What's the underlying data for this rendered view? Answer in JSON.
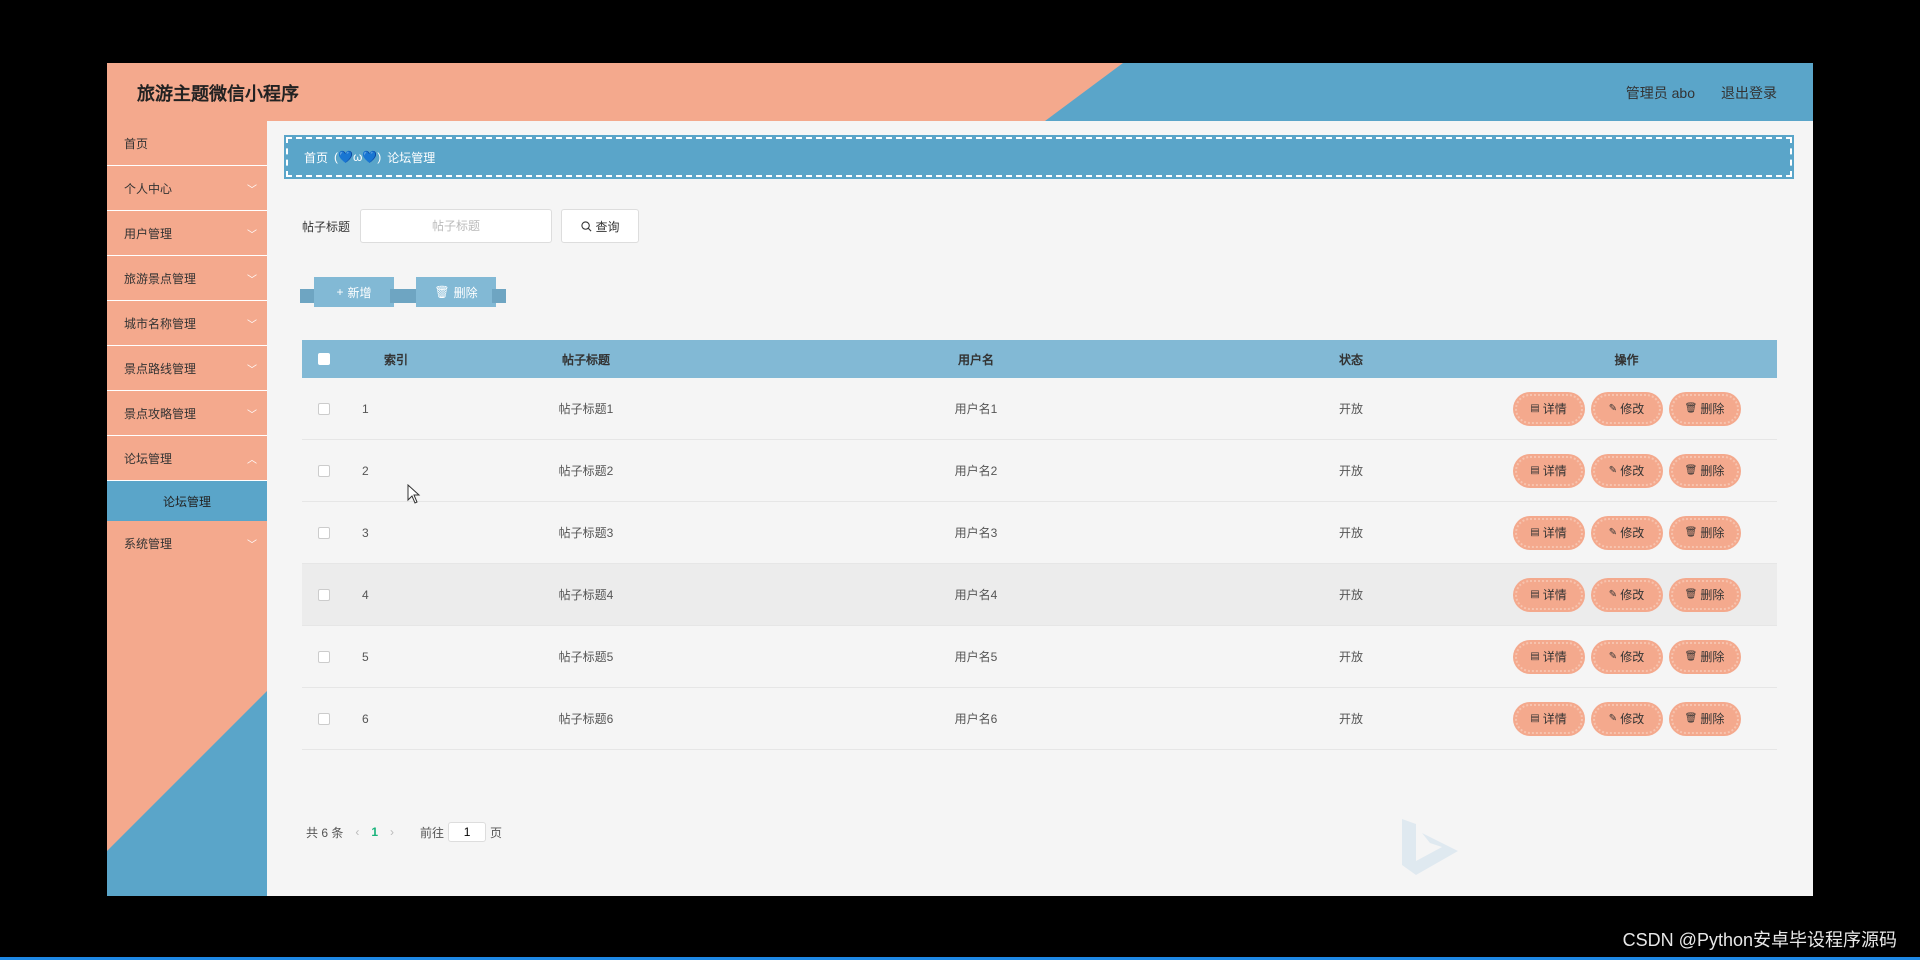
{
  "header": {
    "title": "旅游主题微信小程序",
    "user": "管理员 abo",
    "logout": "退出登录"
  },
  "sidebar": {
    "items": [
      {
        "label": "首页"
      },
      {
        "label": "个人中心"
      },
      {
        "label": "用户管理"
      },
      {
        "label": "旅游景点管理"
      },
      {
        "label": "城市名称管理"
      },
      {
        "label": "景点路线管理"
      },
      {
        "label": "景点攻略管理"
      },
      {
        "label": "论坛管理"
      },
      {
        "label": "系统管理"
      }
    ],
    "submenu": "论坛管理"
  },
  "breadcrumb": {
    "home": "首页",
    "separator": "(💙ω💙)",
    "current": "论坛管理"
  },
  "search": {
    "label": "帖子标题",
    "placeholder": "帖子标题",
    "button": "查询"
  },
  "actions": {
    "add": "新增",
    "delete": "删除"
  },
  "table": {
    "headers": [
      "索引",
      "帖子标题",
      "用户名",
      "状态",
      "操作"
    ],
    "rows": [
      {
        "index": "1",
        "title": "帖子标题1",
        "user": "用户名1",
        "status": "开放"
      },
      {
        "index": "2",
        "title": "帖子标题2",
        "user": "用户名2",
        "status": "开放"
      },
      {
        "index": "3",
        "title": "帖子标题3",
        "user": "用户名3",
        "status": "开放"
      },
      {
        "index": "4",
        "title": "帖子标题4",
        "user": "用户名4",
        "status": "开放"
      },
      {
        "index": "5",
        "title": "帖子标题5",
        "user": "用户名5",
        "status": "开放"
      },
      {
        "index": "6",
        "title": "帖子标题6",
        "user": "用户名6",
        "status": "开放"
      }
    ],
    "ops": {
      "detail": "详情",
      "edit": "修改",
      "delete": "删除"
    }
  },
  "pagination": {
    "total": "共 6 条",
    "current_page": "1",
    "goto_prefix": "前往",
    "goto_value": "1",
    "goto_suffix": "页"
  },
  "watermark": "CSDN @Python安卓毕设程序源码",
  "colors": {
    "salmon": "#f4a98d",
    "blue": "#5aa5c9",
    "table_header": "#82b9d5",
    "page_active": "#19b37b"
  }
}
